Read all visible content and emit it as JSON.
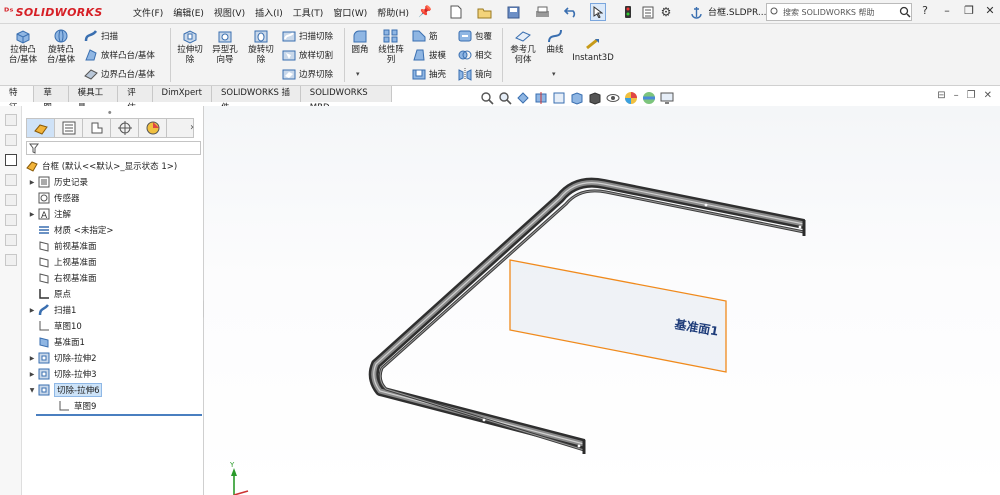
{
  "app": {
    "brand": "SOLIDWORKS",
    "document_title": "台框.SLDPR...",
    "search_placeholder": "搜索 SOLIDWORKS 帮助"
  },
  "menu": [
    "文件(F)",
    "编辑(E)",
    "视图(V)",
    "插入(I)",
    "工具(T)",
    "窗口(W)",
    "帮助(H)"
  ],
  "commands": {
    "extrude_boss": "拉伸凸\n台/基体",
    "revolve_boss": "旋转凸\n台/基体",
    "sweep": "扫描",
    "loft_boss": "放样凸台/基体",
    "boundary_boss": "边界凸台/基体",
    "extrude_cut": "拉伸切\n除",
    "hole_wizard": "异型孔\n向导",
    "revolve_cut": "旋转切\n除",
    "swept_cut": "扫描切除",
    "lofted_cut": "放样切割",
    "boundary_cut": "边界切除",
    "fillet": "圆角",
    "linear_pattern": "线性阵\n列",
    "rib": "筋",
    "draft": "拔模",
    "shell": "抽壳",
    "wrap": "包覆",
    "intersect": "相交",
    "mirror": "镜向",
    "ref_geometry": "参考几\n何体",
    "curves": "曲线",
    "instant3d": "Instant3D"
  },
  "tabs": [
    "特征",
    "草图",
    "模具工具",
    "评估",
    "DimXpert",
    "SOLIDWORKS 插件",
    "SOLIDWORKS MBD"
  ],
  "active_tab": "特征",
  "tree": {
    "root": "台框  (默认<<默认>_显示状态 1>)",
    "items": [
      {
        "label": "历史记录",
        "expandable": true
      },
      {
        "label": "传感器",
        "expandable": false
      },
      {
        "label": "注解",
        "expandable": true
      },
      {
        "label": "材质 <未指定>",
        "expandable": false
      },
      {
        "label": "前视基准面",
        "expandable": false
      },
      {
        "label": "上视基准面",
        "expandable": false
      },
      {
        "label": "右视基准面",
        "expandable": false
      },
      {
        "label": "原点",
        "expandable": false
      },
      {
        "label": "扫描1",
        "expandable": true
      },
      {
        "label": "草图10",
        "expandable": false
      },
      {
        "label": "基准面1",
        "expandable": false
      },
      {
        "label": "切除-拉伸2",
        "expandable": true
      },
      {
        "label": "切除-拉伸3",
        "expandable": true
      },
      {
        "label": "切除-拉伸6",
        "expandable": true,
        "selected": true,
        "expanded": true
      },
      {
        "label": "草图9",
        "expandable": false,
        "child": true
      }
    ]
  },
  "viewport": {
    "plane_label": "基准面1",
    "plane_color": "#f08a1c",
    "label_color": "#1f3d7a",
    "triad_y": "Y"
  }
}
